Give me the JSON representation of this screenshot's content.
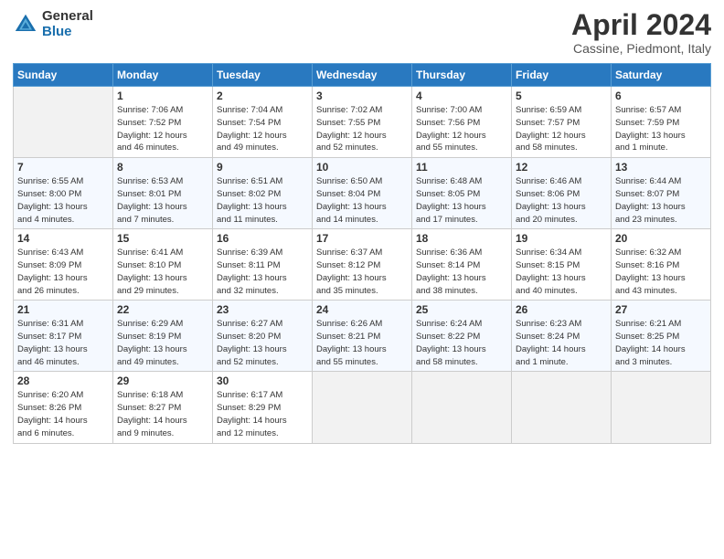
{
  "header": {
    "logo_general": "General",
    "logo_blue": "Blue",
    "month_title": "April 2024",
    "location": "Cassine, Piedmont, Italy"
  },
  "days_of_week": [
    "Sunday",
    "Monday",
    "Tuesday",
    "Wednesday",
    "Thursday",
    "Friday",
    "Saturday"
  ],
  "weeks": [
    [
      {
        "day": "",
        "info": ""
      },
      {
        "day": "1",
        "info": "Sunrise: 7:06 AM\nSunset: 7:52 PM\nDaylight: 12 hours\nand 46 minutes."
      },
      {
        "day": "2",
        "info": "Sunrise: 7:04 AM\nSunset: 7:54 PM\nDaylight: 12 hours\nand 49 minutes."
      },
      {
        "day": "3",
        "info": "Sunrise: 7:02 AM\nSunset: 7:55 PM\nDaylight: 12 hours\nand 52 minutes."
      },
      {
        "day": "4",
        "info": "Sunrise: 7:00 AM\nSunset: 7:56 PM\nDaylight: 12 hours\nand 55 minutes."
      },
      {
        "day": "5",
        "info": "Sunrise: 6:59 AM\nSunset: 7:57 PM\nDaylight: 12 hours\nand 58 minutes."
      },
      {
        "day": "6",
        "info": "Sunrise: 6:57 AM\nSunset: 7:59 PM\nDaylight: 13 hours\nand 1 minute."
      }
    ],
    [
      {
        "day": "7",
        "info": "Sunrise: 6:55 AM\nSunset: 8:00 PM\nDaylight: 13 hours\nand 4 minutes."
      },
      {
        "day": "8",
        "info": "Sunrise: 6:53 AM\nSunset: 8:01 PM\nDaylight: 13 hours\nand 7 minutes."
      },
      {
        "day": "9",
        "info": "Sunrise: 6:51 AM\nSunset: 8:02 PM\nDaylight: 13 hours\nand 11 minutes."
      },
      {
        "day": "10",
        "info": "Sunrise: 6:50 AM\nSunset: 8:04 PM\nDaylight: 13 hours\nand 14 minutes."
      },
      {
        "day": "11",
        "info": "Sunrise: 6:48 AM\nSunset: 8:05 PM\nDaylight: 13 hours\nand 17 minutes."
      },
      {
        "day": "12",
        "info": "Sunrise: 6:46 AM\nSunset: 8:06 PM\nDaylight: 13 hours\nand 20 minutes."
      },
      {
        "day": "13",
        "info": "Sunrise: 6:44 AM\nSunset: 8:07 PM\nDaylight: 13 hours\nand 23 minutes."
      }
    ],
    [
      {
        "day": "14",
        "info": "Sunrise: 6:43 AM\nSunset: 8:09 PM\nDaylight: 13 hours\nand 26 minutes."
      },
      {
        "day": "15",
        "info": "Sunrise: 6:41 AM\nSunset: 8:10 PM\nDaylight: 13 hours\nand 29 minutes."
      },
      {
        "day": "16",
        "info": "Sunrise: 6:39 AM\nSunset: 8:11 PM\nDaylight: 13 hours\nand 32 minutes."
      },
      {
        "day": "17",
        "info": "Sunrise: 6:37 AM\nSunset: 8:12 PM\nDaylight: 13 hours\nand 35 minutes."
      },
      {
        "day": "18",
        "info": "Sunrise: 6:36 AM\nSunset: 8:14 PM\nDaylight: 13 hours\nand 38 minutes."
      },
      {
        "day": "19",
        "info": "Sunrise: 6:34 AM\nSunset: 8:15 PM\nDaylight: 13 hours\nand 40 minutes."
      },
      {
        "day": "20",
        "info": "Sunrise: 6:32 AM\nSunset: 8:16 PM\nDaylight: 13 hours\nand 43 minutes."
      }
    ],
    [
      {
        "day": "21",
        "info": "Sunrise: 6:31 AM\nSunset: 8:17 PM\nDaylight: 13 hours\nand 46 minutes."
      },
      {
        "day": "22",
        "info": "Sunrise: 6:29 AM\nSunset: 8:19 PM\nDaylight: 13 hours\nand 49 minutes."
      },
      {
        "day": "23",
        "info": "Sunrise: 6:27 AM\nSunset: 8:20 PM\nDaylight: 13 hours\nand 52 minutes."
      },
      {
        "day": "24",
        "info": "Sunrise: 6:26 AM\nSunset: 8:21 PM\nDaylight: 13 hours\nand 55 minutes."
      },
      {
        "day": "25",
        "info": "Sunrise: 6:24 AM\nSunset: 8:22 PM\nDaylight: 13 hours\nand 58 minutes."
      },
      {
        "day": "26",
        "info": "Sunrise: 6:23 AM\nSunset: 8:24 PM\nDaylight: 14 hours\nand 1 minute."
      },
      {
        "day": "27",
        "info": "Sunrise: 6:21 AM\nSunset: 8:25 PM\nDaylight: 14 hours\nand 3 minutes."
      }
    ],
    [
      {
        "day": "28",
        "info": "Sunrise: 6:20 AM\nSunset: 8:26 PM\nDaylight: 14 hours\nand 6 minutes."
      },
      {
        "day": "29",
        "info": "Sunrise: 6:18 AM\nSunset: 8:27 PM\nDaylight: 14 hours\nand 9 minutes."
      },
      {
        "day": "30",
        "info": "Sunrise: 6:17 AM\nSunset: 8:29 PM\nDaylight: 14 hours\nand 12 minutes."
      },
      {
        "day": "",
        "info": ""
      },
      {
        "day": "",
        "info": ""
      },
      {
        "day": "",
        "info": ""
      },
      {
        "day": "",
        "info": ""
      }
    ]
  ]
}
